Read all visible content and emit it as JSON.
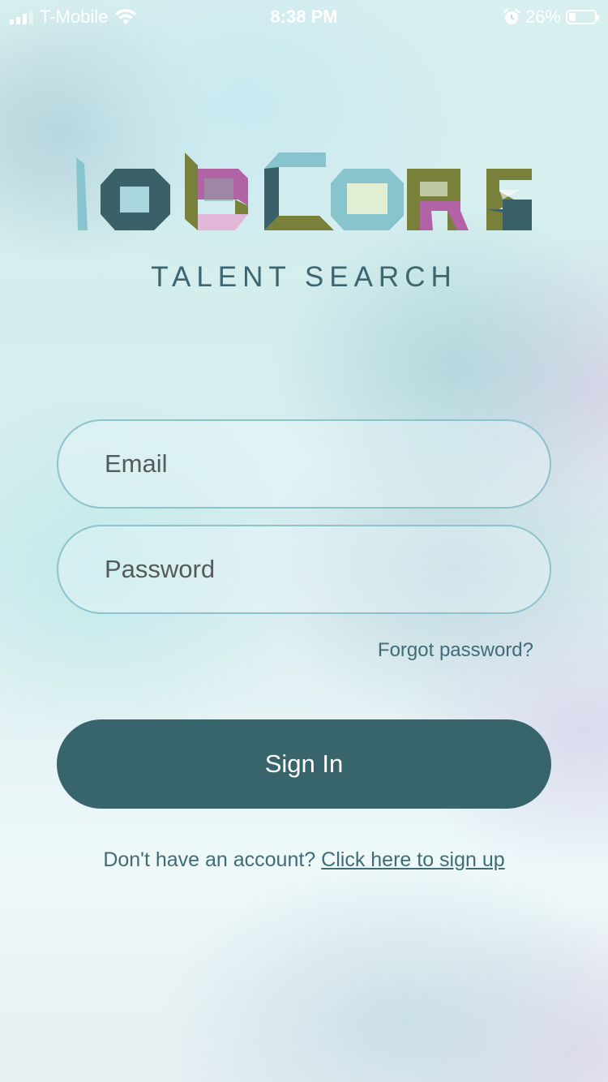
{
  "status_bar": {
    "carrier": "T-Mobile",
    "time": "8:38 PM",
    "battery_percent": "26%",
    "battery_level": 0.26,
    "icons": [
      "signal-icon",
      "wifi-icon",
      "alarm-icon",
      "battery-icon"
    ]
  },
  "logo": {
    "name": "JobCore",
    "tagline": "TALENT SEARCH",
    "colors": {
      "teal_dark": "#3a6068",
      "teal_light": "#88c4ce",
      "olive": "#79803a",
      "magenta": "#b263a6",
      "pink_light": "#e2b8d8",
      "cream": "#e2efd4"
    }
  },
  "form": {
    "email_placeholder": "Email",
    "password_placeholder": "Password",
    "forgot_password": "Forgot password?",
    "sign_in": "Sign In",
    "signup_prompt": "Don't have an account?",
    "signup_link": "Click here to sign up"
  },
  "colors": {
    "primary": "#38646c",
    "input_border": "#8cc3cc",
    "text_link": "#3f6c75"
  }
}
